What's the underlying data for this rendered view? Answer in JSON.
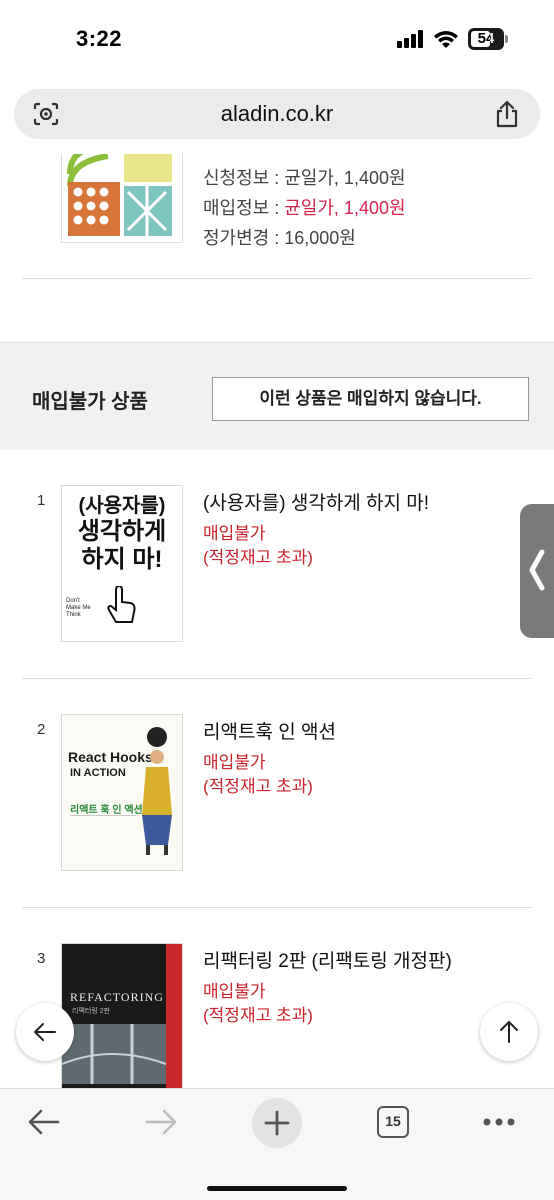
{
  "status_bar": {
    "time": "3:22",
    "battery": "54"
  },
  "browser": {
    "url": "aladin.co.kr"
  },
  "top_item": {
    "lines": [
      {
        "label": "신청정보 : ",
        "value": "균일가, 1,400원",
        "highlight": false
      },
      {
        "label": "매입정보 : ",
        "value": "균일가, 1,400원",
        "highlight": true
      },
      {
        "label": "정가변경 : ",
        "value": "16,000원",
        "highlight": false
      }
    ]
  },
  "unbuyable": {
    "title": "매입불가 상품",
    "button_label": "이런 상품은 매입하지 않습니다."
  },
  "books": [
    {
      "num": "1",
      "title": "(사용자를) 생각하게 하지 마!",
      "status": "매입불가",
      "reason": "(적정재고 초과)",
      "cover": {
        "line1": "(사용자를)",
        "line2": "생각하게",
        "line3": "하지 마!",
        "small": "Don't Make Me Think"
      }
    },
    {
      "num": "2",
      "title": "리액트훅 인 액션",
      "status": "매입불가",
      "reason": "(적정재고 초과)",
      "cover": {
        "line1": "React Hooks",
        "line2": "IN ACTION",
        "line3": "리액트 훅 인 액션"
      }
    },
    {
      "num": "3",
      "title": "리팩터링 2판 (리팩토링 개정판)",
      "status": "매입불가",
      "reason": "(적정재고 초과)",
      "cover": {
        "line1": "REFACTORING",
        "line2": "리팩터링 2판"
      }
    }
  ],
  "toolbar": {
    "tab_count": "15"
  },
  "colors": {
    "accent_red": "#c8242d",
    "highlight_pink": "#d8234f"
  }
}
